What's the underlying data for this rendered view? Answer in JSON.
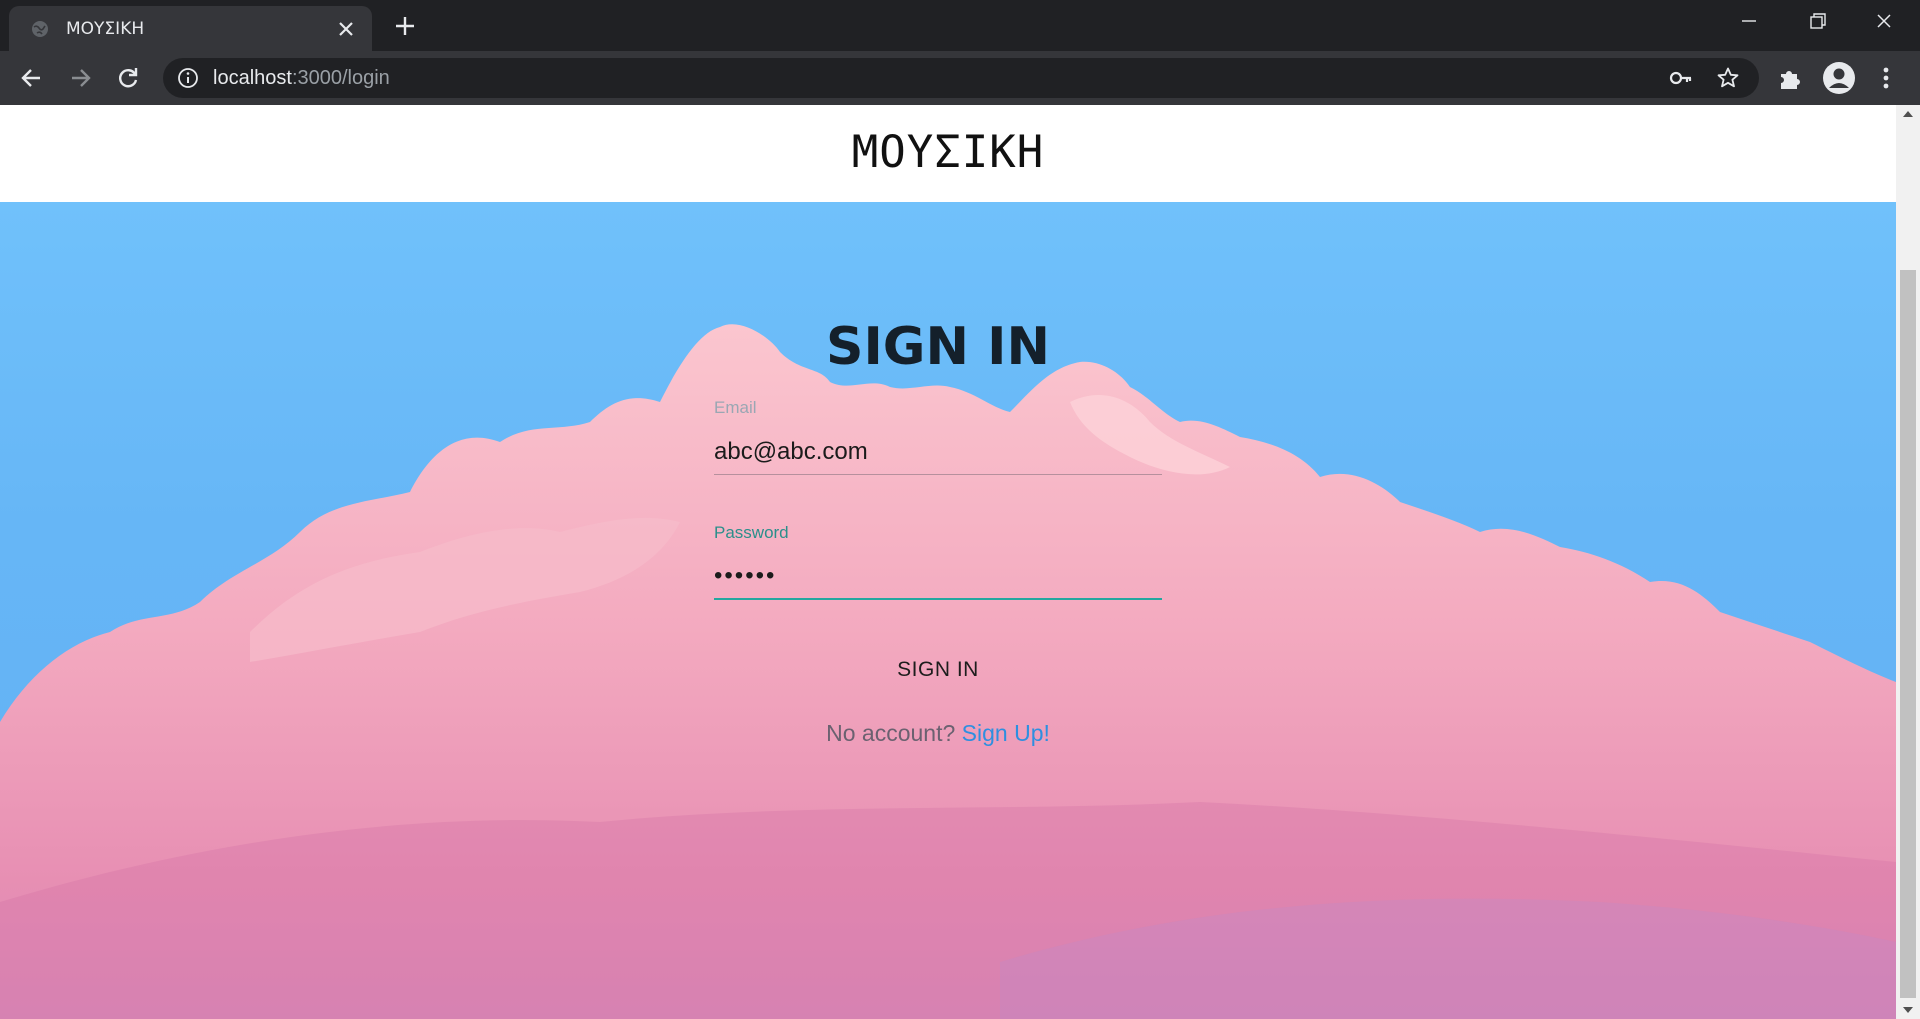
{
  "browser": {
    "tab_title": "ΜΟΥΣΙΚΗ",
    "url_host": "localhost",
    "url_path": ":3000/login"
  },
  "site": {
    "brand": "ΜΟΥΣΙΚΗ"
  },
  "login": {
    "title": "SIGN IN",
    "email_label": "Email",
    "email_value": "abc@abc.com",
    "password_label": "Password",
    "password_value": "••••••",
    "submit_label": "SIGN IN",
    "no_account_text": "No account?",
    "signup_link": "Sign Up!"
  },
  "colors": {
    "sky": "#66b6f6",
    "cloud": "#f6b8c4",
    "accent_teal": "#23a79f",
    "link_blue": "#2e8fe0"
  }
}
